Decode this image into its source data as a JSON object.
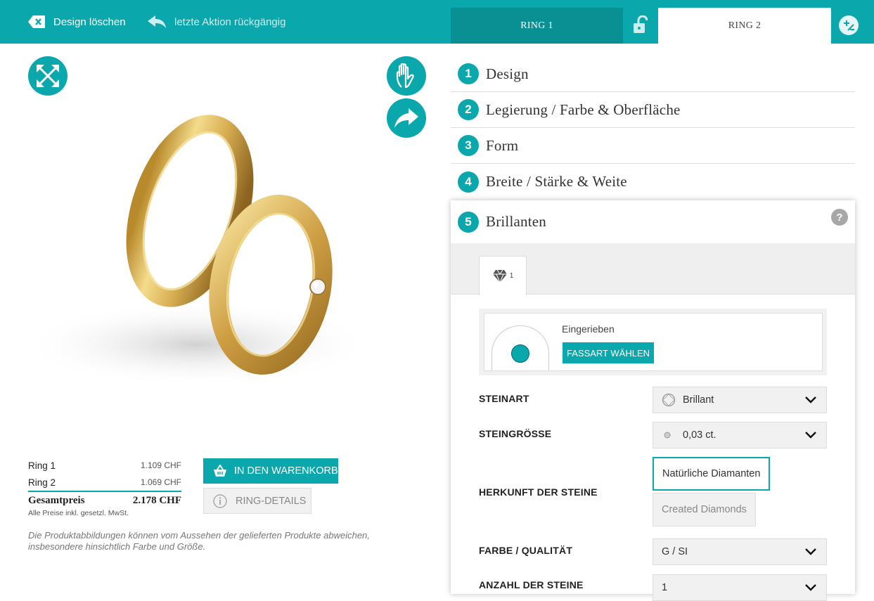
{
  "topbar": {
    "delete_label": "Design löschen",
    "undo_label": "letzte Aktion rückgängig",
    "ring1_tab": "RING 1",
    "ring2_tab": "RING 2"
  },
  "steps": [
    {
      "num": "1",
      "label": "Design"
    },
    {
      "num": "2",
      "label": "Legierung / Farbe & Oberfläche"
    },
    {
      "num": "3",
      "label": "Form"
    },
    {
      "num": "4",
      "label": "Breite / Stärke & Weite"
    }
  ],
  "active_step": {
    "num": "5",
    "label": "Brillanten",
    "help": "?"
  },
  "stone_tab": {
    "count": "1"
  },
  "setting": {
    "name": "Eingerieben",
    "button": "FASSART WÄHLEN"
  },
  "options": {
    "steinart": {
      "label": "STEINART",
      "value": "Brillant"
    },
    "steingroesse": {
      "label": "STEINGRÖSSE",
      "value": "0,03 ct."
    },
    "herkunft": {
      "label": "HERKUNFT DER STEINE",
      "choices": [
        "Natürliche Diamanten",
        "Created Diamonds"
      ],
      "selected": "Natürliche Diamanten"
    },
    "farbe": {
      "label": "FARBE / QUALITÄT",
      "value": "G / SI"
    },
    "anzahl": {
      "label": "ANZAHL DER STEINE",
      "value": "1"
    }
  },
  "prices": {
    "ring1_label": "Ring 1",
    "ring1_value": "1.109 CHF",
    "ring2_label": "Ring 2",
    "ring2_value": "1.069 CHF",
    "total_label": "Gesamtpreis",
    "total_value": "2.178 CHF",
    "vat_note": "Alle Preise inkl. gesetzl. MwSt."
  },
  "buttons": {
    "cart": "IN DEN WARENKORB",
    "details": "RING-DETAILS"
  },
  "disclaimer": "Die Produktabbildungen können vom Aussehen der gelieferten Produkte abweichen, insbesondere hinsichtlich Farbe und Größe.",
  "colors": {
    "accent": "#0aa8ad",
    "accent_dark": "#0a8f93",
    "gold": "#d9b45a"
  }
}
